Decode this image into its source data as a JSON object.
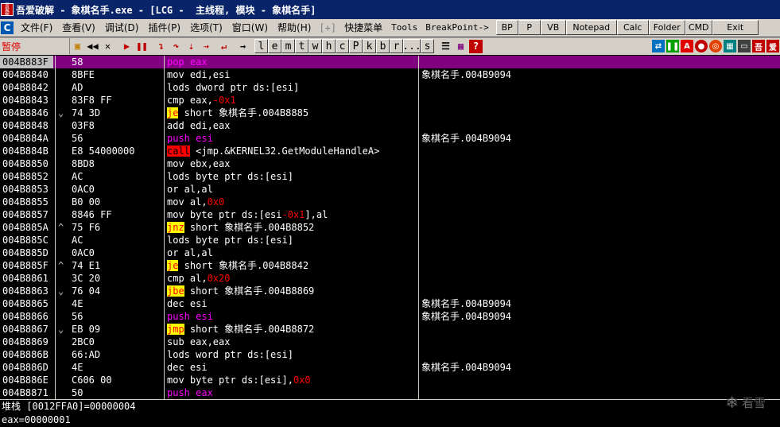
{
  "titlebar": {
    "icon_text": [
      "吾",
      "爱",
      "破"
    ],
    "title": "吾爱破解 - 象棋名手.exe - [LCG -  主线程, 模块 - 象棋名手]"
  },
  "menubar": {
    "items": [
      "文件(F)",
      "查看(V)",
      "调试(D)",
      "插件(P)",
      "选项(T)",
      "窗口(W)",
      "帮助(H)"
    ],
    "bracket": "[+]",
    "quick_menu": "快捷菜单",
    "tools": "Tools",
    "breakpoint": "BreakPoint->",
    "buttons": [
      "BP",
      "P",
      "VB",
      "Notepad",
      "Calc",
      "Folder",
      "CMD",
      "Exit"
    ]
  },
  "toolbar": {
    "status": "暂停",
    "letters": [
      "l",
      "e",
      "m",
      "t",
      "w",
      "h",
      "c",
      "P",
      "k",
      "b",
      "r",
      "...",
      "s"
    ],
    "right_icons": [
      "refresh-icon",
      "pause-green-icon",
      "a-icon",
      "record-icon",
      "target-icon",
      "grid-icon",
      "window-icon",
      "wu-icon",
      "ai-icon"
    ],
    "right_icon_text": {
      "a": "A",
      "wu": "吾",
      "ai": "爱"
    }
  },
  "disasm": [
    {
      "addr": "004B883F",
      "arrow": "",
      "hex": "58",
      "parts": [
        {
          "t": "pop eax",
          "c": "push"
        }
      ],
      "comment": "",
      "sel": true
    },
    {
      "addr": "004B8840",
      "arrow": "",
      "hex": "8BFE",
      "parts": [
        {
          "t": "mov edi,esi",
          "c": "def"
        }
      ],
      "comment": "象棋名手.004B9094"
    },
    {
      "addr": "004B8842",
      "arrow": "",
      "hex": "AD",
      "parts": [
        {
          "t": "lods dword ptr ds:[esi]",
          "c": "def"
        }
      ],
      "comment": ""
    },
    {
      "addr": "004B8843",
      "arrow": "",
      "hex": "83F8 FF",
      "parts": [
        {
          "t": "cmp eax,",
          "c": "def"
        },
        {
          "t": "-0x1",
          "c": "num"
        }
      ],
      "comment": ""
    },
    {
      "addr": "004B8846",
      "arrow": "⌄",
      "hex": "74 3D",
      "parts": [
        {
          "t": "je",
          "c": "jcc"
        },
        {
          "t": " short 象棋名手.004B8885",
          "c": "def"
        }
      ],
      "comment": ""
    },
    {
      "addr": "004B8848",
      "arrow": "",
      "hex": "03F8",
      "parts": [
        {
          "t": "add edi,eax",
          "c": "def"
        }
      ],
      "comment": ""
    },
    {
      "addr": "004B884A",
      "arrow": "",
      "hex": "56",
      "parts": [
        {
          "t": "push esi",
          "c": "push"
        }
      ],
      "comment": "象棋名手.004B9094"
    },
    {
      "addr": "004B884B",
      "arrow": "",
      "hex": "E8 54000000",
      "parts": [
        {
          "t": "call",
          "c": "call"
        },
        {
          "t": " <jmp.&KERNEL32.GetModuleHandleA>",
          "c": "def"
        }
      ],
      "comment": ""
    },
    {
      "addr": "004B8850",
      "arrow": "",
      "hex": "8BD8",
      "parts": [
        {
          "t": "mov ebx,eax",
          "c": "def"
        }
      ],
      "comment": ""
    },
    {
      "addr": "004B8852",
      "arrow": "",
      "hex": "AC",
      "parts": [
        {
          "t": "lods byte ptr ds:[esi]",
          "c": "def"
        }
      ],
      "comment": ""
    },
    {
      "addr": "004B8853",
      "arrow": "",
      "hex": "0AC0",
      "parts": [
        {
          "t": "or al,al",
          "c": "def"
        }
      ],
      "comment": ""
    },
    {
      "addr": "004B8855",
      "arrow": "",
      "hex": "B0 00",
      "parts": [
        {
          "t": "mov al,",
          "c": "def"
        },
        {
          "t": "0x0",
          "c": "num"
        }
      ],
      "comment": ""
    },
    {
      "addr": "004B8857",
      "arrow": "",
      "hex": "8846 FF",
      "parts": [
        {
          "t": "mov byte ptr ds:[esi",
          "c": "def"
        },
        {
          "t": "-0x1",
          "c": "num"
        },
        {
          "t": "],al",
          "c": "def"
        }
      ],
      "comment": ""
    },
    {
      "addr": "004B885A",
      "arrow": "^",
      "hex": "75 F6",
      "parts": [
        {
          "t": "jnz",
          "c": "jcc"
        },
        {
          "t": " short 象棋名手.004B8852",
          "c": "def"
        }
      ],
      "comment": ""
    },
    {
      "addr": "004B885C",
      "arrow": "",
      "hex": "AC",
      "parts": [
        {
          "t": "lods byte ptr ds:[esi]",
          "c": "def"
        }
      ],
      "comment": ""
    },
    {
      "addr": "004B885D",
      "arrow": "",
      "hex": "0AC0",
      "parts": [
        {
          "t": "or al,al",
          "c": "def"
        }
      ],
      "comment": ""
    },
    {
      "addr": "004B885F",
      "arrow": "^",
      "hex": "74 E1",
      "parts": [
        {
          "t": "je",
          "c": "jcc"
        },
        {
          "t": " short 象棋名手.004B8842",
          "c": "def"
        }
      ],
      "comment": ""
    },
    {
      "addr": "004B8861",
      "arrow": "",
      "hex": "3C 20",
      "parts": [
        {
          "t": "cmp al,",
          "c": "def"
        },
        {
          "t": "0x20",
          "c": "num"
        }
      ],
      "comment": ""
    },
    {
      "addr": "004B8863",
      "arrow": "⌄",
      "hex": "76 04",
      "parts": [
        {
          "t": "jbe",
          "c": "jcc"
        },
        {
          "t": " short 象棋名手.004B8869",
          "c": "def"
        }
      ],
      "comment": ""
    },
    {
      "addr": "004B8865",
      "arrow": "",
      "hex": "4E",
      "parts": [
        {
          "t": "dec esi",
          "c": "def"
        }
      ],
      "comment": "象棋名手.004B9094"
    },
    {
      "addr": "004B8866",
      "arrow": "",
      "hex": "56",
      "parts": [
        {
          "t": "push esi",
          "c": "push"
        }
      ],
      "comment": "象棋名手.004B9094"
    },
    {
      "addr": "004B8867",
      "arrow": "⌄",
      "hex": "EB 09",
      "parts": [
        {
          "t": "jmp",
          "c": "jcc"
        },
        {
          "t": " short 象棋名手.004B8872",
          "c": "def"
        }
      ],
      "comment": ""
    },
    {
      "addr": "004B8869",
      "arrow": "",
      "hex": "2BC0",
      "parts": [
        {
          "t": "sub eax,eax",
          "c": "def"
        }
      ],
      "comment": ""
    },
    {
      "addr": "004B886B",
      "arrow": "",
      "hex": "66:AD",
      "parts": [
        {
          "t": "lods word ptr ds:[esi]",
          "c": "def"
        }
      ],
      "comment": ""
    },
    {
      "addr": "004B886D",
      "arrow": "",
      "hex": "4E",
      "parts": [
        {
          "t": "dec esi",
          "c": "def"
        }
      ],
      "comment": "象棋名手.004B9094"
    },
    {
      "addr": "004B886E",
      "arrow": "",
      "hex": "C606 00",
      "parts": [
        {
          "t": "mov byte ptr ds:[esi],",
          "c": "def"
        },
        {
          "t": "0x0",
          "c": "num"
        }
      ],
      "comment": ""
    },
    {
      "addr": "004B8871",
      "arrow": "",
      "hex": "50",
      "parts": [
        {
          "t": "push eax",
          "c": "push"
        }
      ],
      "comment": ""
    }
  ],
  "info": {
    "label": "堆栈",
    "value": " [0012FFA0]=00000004"
  },
  "command": "eax=00000001",
  "watermark": "看雪"
}
